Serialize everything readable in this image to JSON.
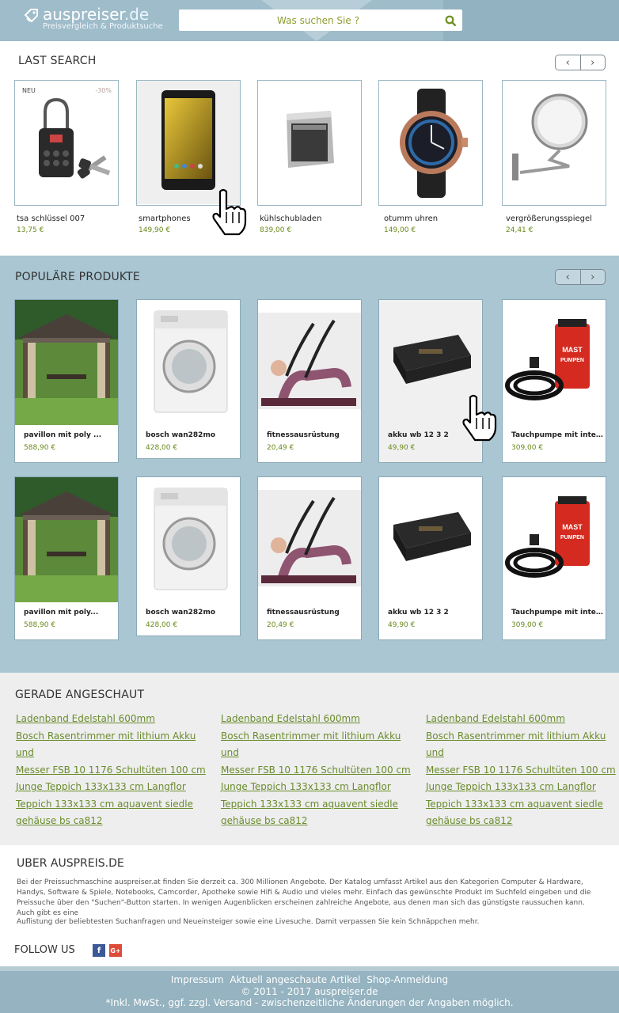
{
  "header": {
    "logo_main": "auspreiser",
    "logo_tld": ".de",
    "logo_tagline": "Preisvergleich & Produktsuche",
    "search_placeholder": "Was suchen Sie ?"
  },
  "last_search": {
    "title": "LAST SEARCH",
    "items": [
      {
        "name": "tsa schlüssel 007",
        "price": "13,75 €",
        "badge_new": "NEU",
        "badge_discount": "-30%"
      },
      {
        "name": "smartphones",
        "price": "149,90 €"
      },
      {
        "name": "kühlschubladen",
        "price": "839,00 €"
      },
      {
        "name": "otumm uhren",
        "price": "149,00 €"
      },
      {
        "name": "vergrößerungsspiegel",
        "price": "24,41 €"
      }
    ]
  },
  "popular": {
    "title": "POPULÄRE PRODUKTE",
    "rows": [
      [
        {
          "name": "pavillon mit poly ...",
          "price": "588,90 €"
        },
        {
          "name": "bosch wan282mo",
          "price": "428,00 €"
        },
        {
          "name": "fitnessausrüstung",
          "price": "20,49 €"
        },
        {
          "name": "akku wb 12 3 2",
          "price": "49,90 €"
        },
        {
          "name": "Tauchpumpe mit integr...",
          "price": "309,00 €"
        }
      ],
      [
        {
          "name": "pavillon mit poly...",
          "price": "588,90 €"
        },
        {
          "name": "bosch wan282mo",
          "price": "428,00 €"
        },
        {
          "name": "fitnessausrüstung",
          "price": "20,49 €"
        },
        {
          "name": "akku wb 12 3 2",
          "price": "49,90 €"
        },
        {
          "name": "Tauchpumpe mit integr...",
          "price": "309,00 €"
        }
      ]
    ],
    "pump_brand": "MAST PUMPEN"
  },
  "recent": {
    "title": "GERADE ANGESCHAUT",
    "links": [
      "Ladenband Edelstahl 600mm",
      "Bosch Rasentrimmer mit lithium Akku und",
      "Messer FSB 10 1176 Schultüten 100 cm",
      "Junge Teppich 133x133 cm Langflor",
      "Teppich 133x133 cm aquavent siedle",
      "gehäuse bs ca812"
    ]
  },
  "about": {
    "title": "UBER AUSPREIS.DE",
    "text1": "Bei der Preissuchmaschine auspreiser.at finden Sie derzeit ca. 300 Millionen Angebote. Der Katalog umfasst Artikel aus den Kategorien Computer & Hardware, Handys, Software & Spiele, Notebooks, Camcorder, Apotheke sowie Hifi & Audio und vieles mehr. Einfach das gewünschte Produkt im Suchfeld eingeben und die Preissuche über den \"Suchen\"-Button starten. In wenigen Augenblicken erscheinen zahlreiche Angebote, aus denen man sich das günstigste raussuchen kann. Auch gibt es eine",
    "text2": "Auflistung der beliebtesten Suchanfragen und Neueinsteiger sowie eine Livesuche. Damit verpassen Sie kein Schnäppchen mehr."
  },
  "follow": {
    "label": "FOLLOW US",
    "facebook": "f",
    "google": "G+"
  },
  "footer": {
    "links": [
      "Impressum",
      "Aktuell angeschaute Artikel",
      "Shop-Anmeldung"
    ],
    "copyright": "© 2011 - 2017 auspreiser.de",
    "disclaimer": "*Inkl. MwSt., ggf. zzgl. Versand - zwischenzeitliche Änderungen der Angaben möglich."
  },
  "colors": {
    "accent_green": "#6a8a1b",
    "header_blue": "#9fbcca",
    "popular_bg": "#a9c6d2"
  }
}
